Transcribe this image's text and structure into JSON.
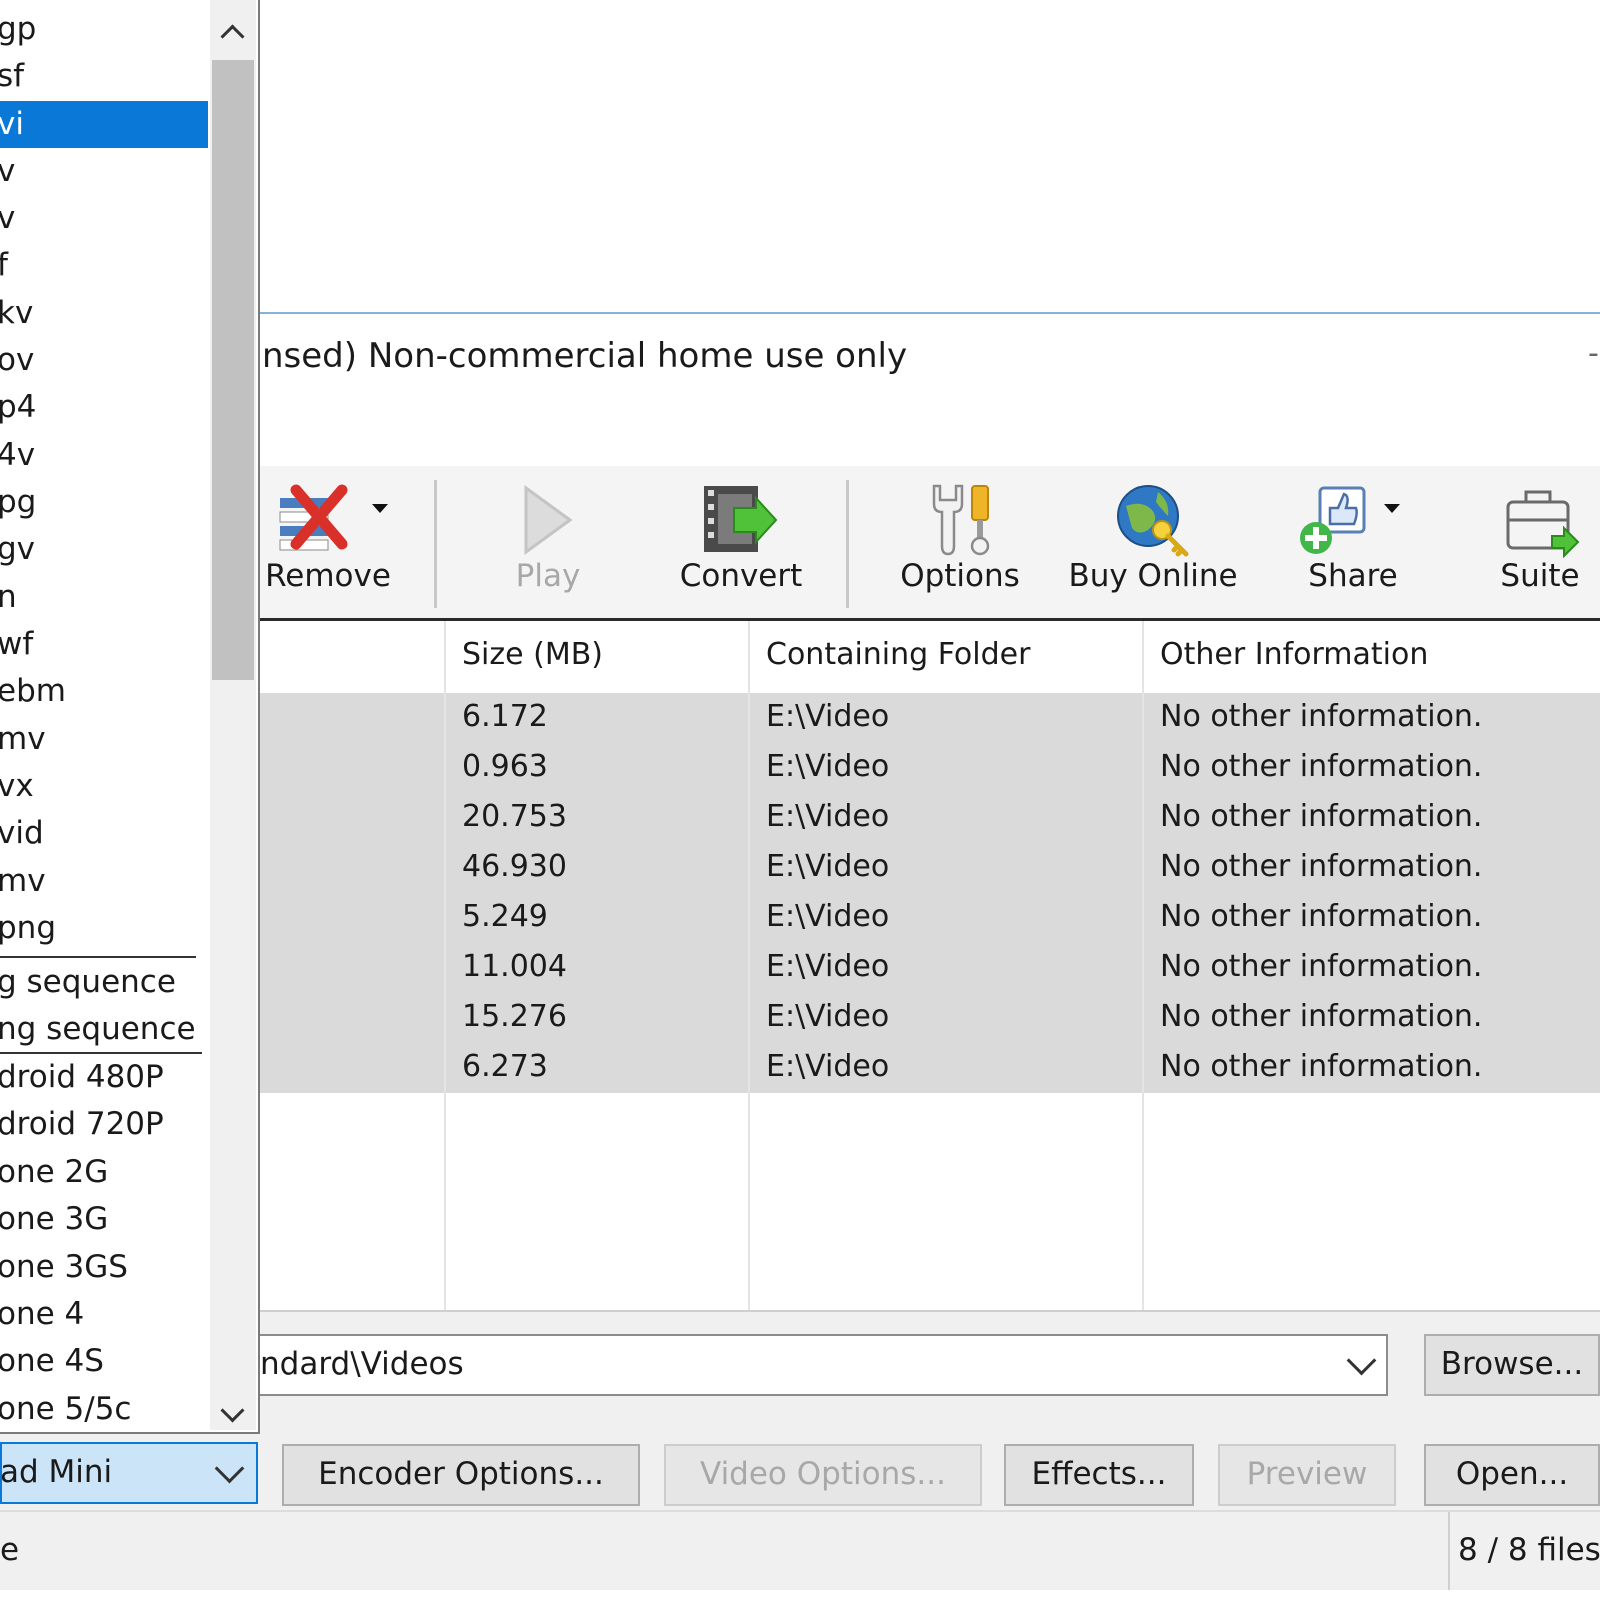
{
  "window": {
    "title": "nsed) Non-commercial home use only",
    "title_control": "-"
  },
  "toolbar": {
    "buttons": [
      {
        "label": "Remove",
        "icon": "remove-icon",
        "enabled": true,
        "has_dropdown": true
      },
      {
        "label": "Play",
        "icon": "play-icon",
        "enabled": false,
        "has_dropdown": false
      },
      {
        "label": "Convert",
        "icon": "convert-icon",
        "enabled": true,
        "has_dropdown": false
      },
      {
        "label": "Options",
        "icon": "options-icon",
        "enabled": true,
        "has_dropdown": false
      },
      {
        "label": "Buy Online",
        "icon": "buy-online-icon",
        "enabled": true,
        "has_dropdown": false
      },
      {
        "label": "Share",
        "icon": "share-icon",
        "enabled": true,
        "has_dropdown": true
      },
      {
        "label": "Suite",
        "icon": "suite-icon",
        "enabled": true,
        "has_dropdown": false
      }
    ]
  },
  "file_list": {
    "columns": [
      "Size (MB)",
      "Containing Folder",
      "Other Information"
    ],
    "rows": [
      {
        "size": "6.172",
        "folder": "E:\\Video",
        "info": "No other information."
      },
      {
        "size": "0.963",
        "folder": "E:\\Video",
        "info": "No other information."
      },
      {
        "size": "20.753",
        "folder": "E:\\Video",
        "info": "No other information."
      },
      {
        "size": "46.930",
        "folder": "E:\\Video",
        "info": "No other information."
      },
      {
        "size": "5.249",
        "folder": "E:\\Video",
        "info": "No other information."
      },
      {
        "size": "11.004",
        "folder": "E:\\Video",
        "info": "No other information."
      },
      {
        "size": "15.276",
        "folder": "E:\\Video",
        "info": "No other information."
      },
      {
        "size": "6.273",
        "folder": "E:\\Video",
        "info": "No other information."
      }
    ]
  },
  "output": {
    "folder_value": "ndard\\Videos",
    "browse_label": "Browse...",
    "encoder_options_label": "Encoder Options...",
    "video_options_label": "Video Options...",
    "effects_label": "Effects...",
    "preview_label": "Preview",
    "open_label": "Open..."
  },
  "format_selector": {
    "selected_value": "ad Mini",
    "options": [
      "gp",
      "sf",
      "vi",
      "v",
      "v",
      "f",
      "kv",
      "ov",
      "p4",
      "4v",
      "pg",
      "gv",
      "n",
      "wf",
      "ebm",
      "mv",
      "vx",
      "vid",
      "mv",
      "png",
      "g sequence",
      "ng sequence",
      "droid 480P",
      "droid 720P",
      "one 2G",
      "one 3G",
      "one 3GS",
      "one 4",
      "one 4S",
      "one 5/5c"
    ],
    "highlighted": "vi"
  },
  "status": {
    "left": "e",
    "right": "8 / 8 files"
  }
}
